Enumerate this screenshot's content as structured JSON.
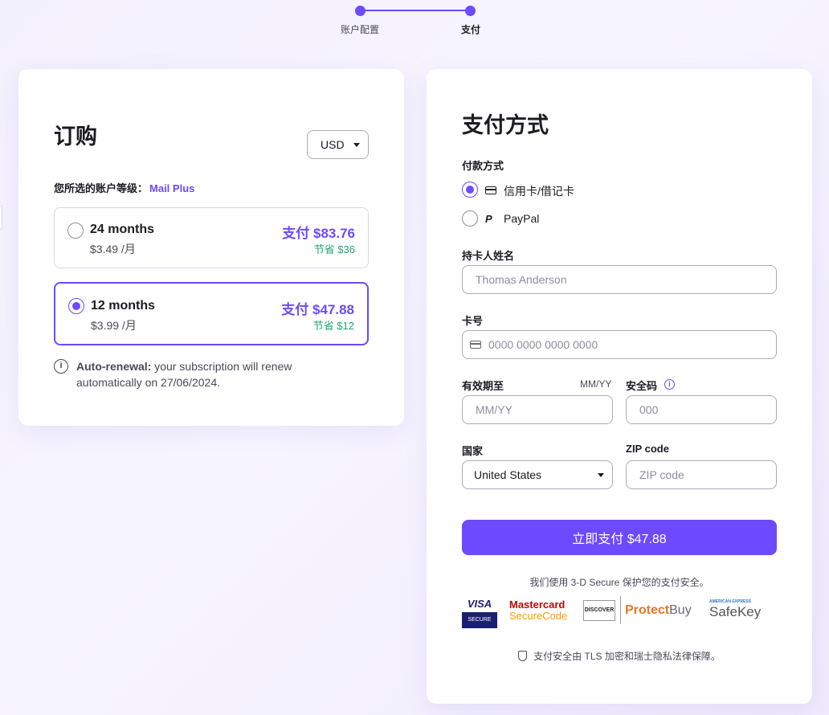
{
  "stepper": {
    "step1": "账户配置",
    "step2": "支付"
  },
  "order": {
    "title": "订购",
    "currency": "USD",
    "tier_label": "您所选的账户等级：",
    "tier_name": "Mail Plus",
    "plans": [
      {
        "name": "24 months",
        "per_month": "$3.49 /月",
        "price": "支付 $83.76",
        "save": "节省 $36",
        "selected": false
      },
      {
        "name": "12 months",
        "per_month": "$3.99 /月",
        "price": "支付 $47.88",
        "save": "节省 $12",
        "selected": true
      }
    ],
    "renewal_bold": "Auto-renewal:",
    "renewal_text": " your subscription will renew automatically on 27/06/2024."
  },
  "payment": {
    "title": "支付方式",
    "method_label": "付款方式",
    "methods": [
      {
        "label": "信用卡/借记卡",
        "icon": "credit-card-icon",
        "selected": true
      },
      {
        "label": "PayPal",
        "icon": "paypal-icon",
        "selected": false
      }
    ],
    "cardholder_label": "持卡人姓名",
    "cardholder_placeholder": "Thomas Anderson",
    "cardnumber_label": "卡号",
    "cardnumber_placeholder": "0000 0000 0000 0000",
    "expiry_label": "有效期至",
    "expiry_hint": "MM/YY",
    "expiry_placeholder": "MM/YY",
    "cvc_label": "安全码",
    "cvc_placeholder": "000",
    "country_label": "国家",
    "country_value": "United States",
    "zip_label": "ZIP code",
    "zip_placeholder": "ZIP code",
    "pay_button": "立即支付 $47.88",
    "secure_note": "我们使用 3-D Secure 保护您的支付安全。",
    "badges": {
      "visa_top": "VISA",
      "visa_bottom": "SECURE",
      "mc_line1": "Mastercard",
      "mc_line2": "SecureCode",
      "discover": "DISCOVER",
      "protect_main": "Protect",
      "protect_tail": "Buy",
      "amex_top": "AMERICAN EXPRESS",
      "amex_main": "SafeKey"
    },
    "tls_note": "支付安全由 TLS 加密和瑞士隐私法律保障。"
  },
  "colors": {
    "accent": "#6d4aff",
    "save_green": "#1ea672"
  }
}
